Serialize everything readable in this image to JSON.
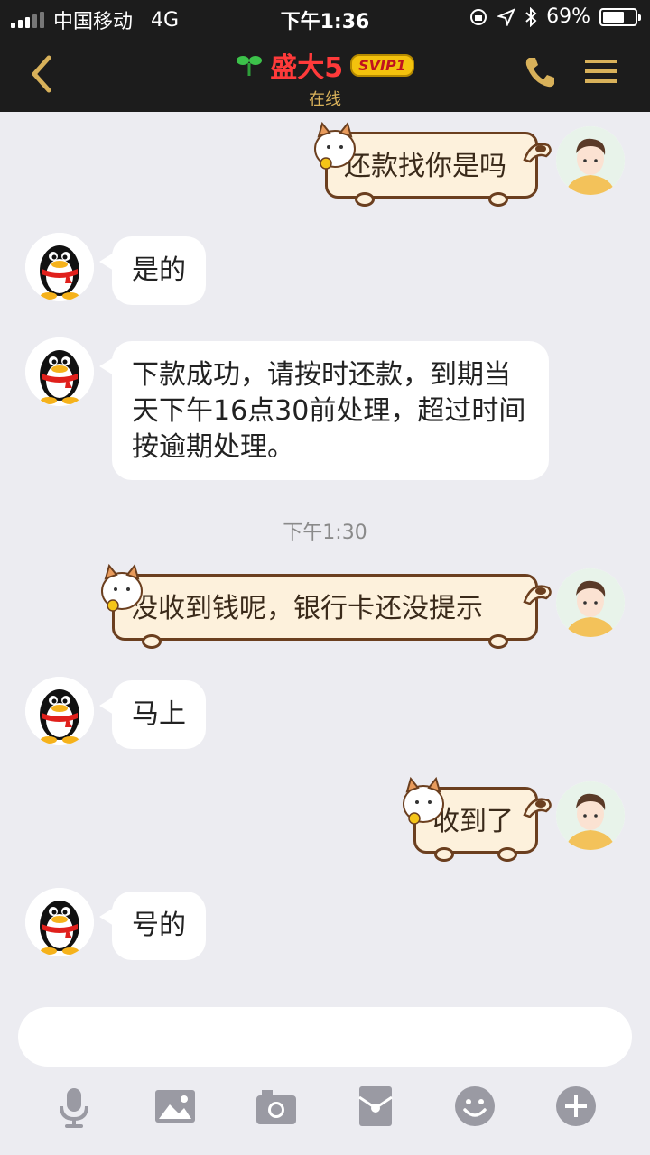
{
  "status_bar": {
    "carrier": "中国移动",
    "network": "4G",
    "time": "下午1:36",
    "battery": "69%",
    "battery_level": 0.69
  },
  "header": {
    "title": "盛大5",
    "badge": "SVIP1",
    "status": "在线"
  },
  "messages": [
    {
      "side": "right",
      "text": "还款找你是吗"
    },
    {
      "side": "left",
      "text": "是的"
    },
    {
      "side": "left",
      "text": "下款成功，请按时还款，到期当天下午16点30前处理，超过时间 按逾期处理。"
    },
    {
      "side": "right",
      "text": "没收到钱呢，银行卡还没提示"
    },
    {
      "side": "left",
      "text": "马上"
    },
    {
      "side": "right",
      "text": "收到了"
    },
    {
      "side": "left",
      "text": "号的"
    }
  ],
  "timestamp": "下午1:30",
  "input": {
    "placeholder": ""
  },
  "toolbar": {
    "icons": [
      "microphone-icon",
      "image-icon",
      "camera-icon",
      "red-packet-icon",
      "emoji-icon",
      "plus-icon"
    ]
  },
  "colors": {
    "nav_bg": "#1c1c1c",
    "accent_gold": "#d8b15a",
    "title_red": "#ff3a3a",
    "chat_bg": "#ececf1"
  }
}
